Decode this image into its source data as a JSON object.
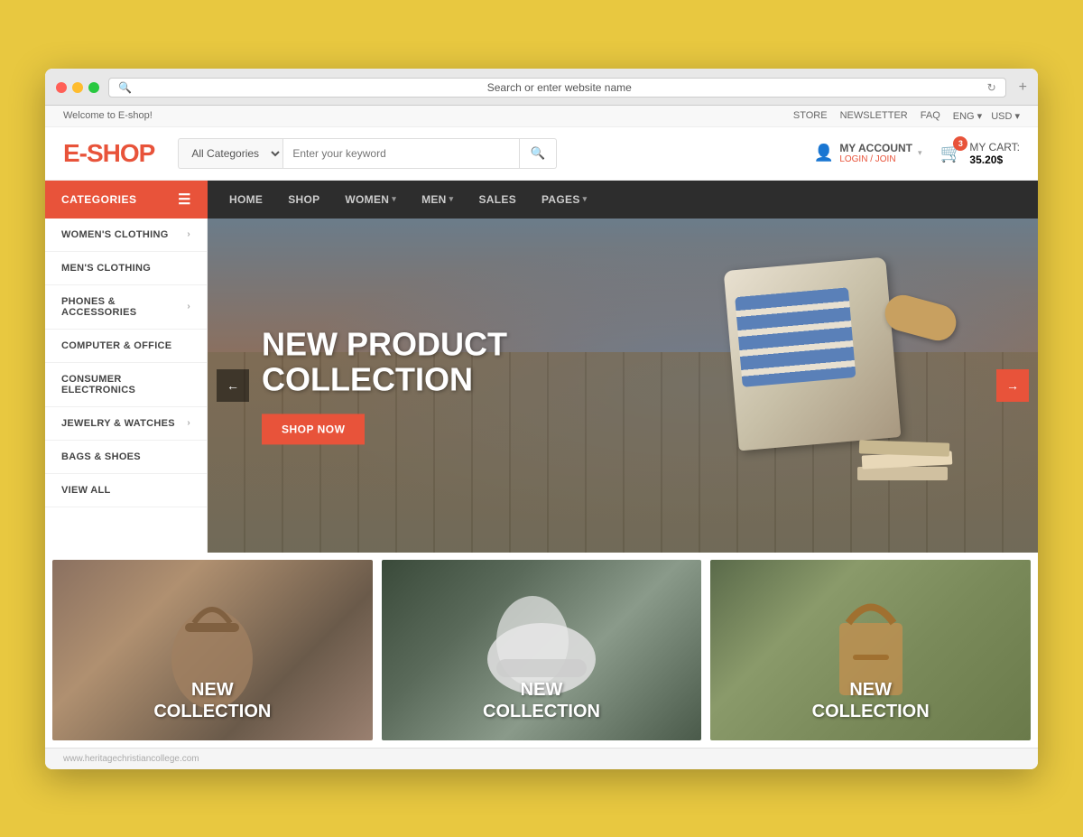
{
  "browser": {
    "address": "Search or enter website name",
    "add_tab": "+"
  },
  "topbar": {
    "welcome": "Welcome to E-shop!",
    "links": [
      "STORE",
      "NEWSLETTER",
      "FAQ"
    ],
    "lang": "ENG",
    "currency": "USD"
  },
  "header": {
    "logo_prefix": "E-",
    "logo_suffix": "SHOP",
    "category_placeholder": "All Categories",
    "search_placeholder": "Enter your keyword",
    "account_label": "MY ACCOUNT",
    "account_sub": "LOGIN / JOIN",
    "cart_label": "MY CART:",
    "cart_total": "35.20$",
    "cart_count": "3"
  },
  "navbar": {
    "categories_label": "CATEGORIES",
    "nav_items": [
      {
        "label": "HOME",
        "has_dropdown": false
      },
      {
        "label": "SHOP",
        "has_dropdown": false
      },
      {
        "label": "WOMEN",
        "has_dropdown": true
      },
      {
        "label": "MEN",
        "has_dropdown": true
      },
      {
        "label": "SALES",
        "has_dropdown": false
      },
      {
        "label": "PAGES",
        "has_dropdown": true
      }
    ]
  },
  "sidebar": {
    "items": [
      {
        "label": "WOMEN'S CLOTHING",
        "has_arrow": true
      },
      {
        "label": "MEN'S CLOTHING",
        "has_arrow": false
      },
      {
        "label": "PHONES & ACCESSORIES",
        "has_arrow": true
      },
      {
        "label": "COMPUTER & OFFICE",
        "has_arrow": false
      },
      {
        "label": "CONSUMER ELECTRONICS",
        "has_arrow": false
      },
      {
        "label": "JEWELRY & WATCHES",
        "has_arrow": true
      },
      {
        "label": "BAGS & SHOES",
        "has_arrow": false
      },
      {
        "label": "VIEW ALL",
        "has_arrow": false
      }
    ]
  },
  "hero": {
    "title_line1": "NEW PRODUCT",
    "title_line2": "COLLECTION",
    "shop_btn": "SHOP NOW",
    "prev_arrow": "←",
    "next_arrow": "→"
  },
  "promo": {
    "cards": [
      {
        "title_line1": "NEW",
        "title_line2": "COLLECTION"
      },
      {
        "title_line1": "NEW",
        "title_line2": "COLLECTION"
      },
      {
        "title_line1": "NEW",
        "title_line2": "COLLECTION"
      }
    ]
  },
  "footer": {
    "url": "www.heritagechristiancollege.com"
  },
  "colors": {
    "accent": "#e8533a",
    "dark_nav": "#2d2d2d",
    "sidebar_bg": "#ffffff",
    "hero_btn": "#e8533a"
  }
}
